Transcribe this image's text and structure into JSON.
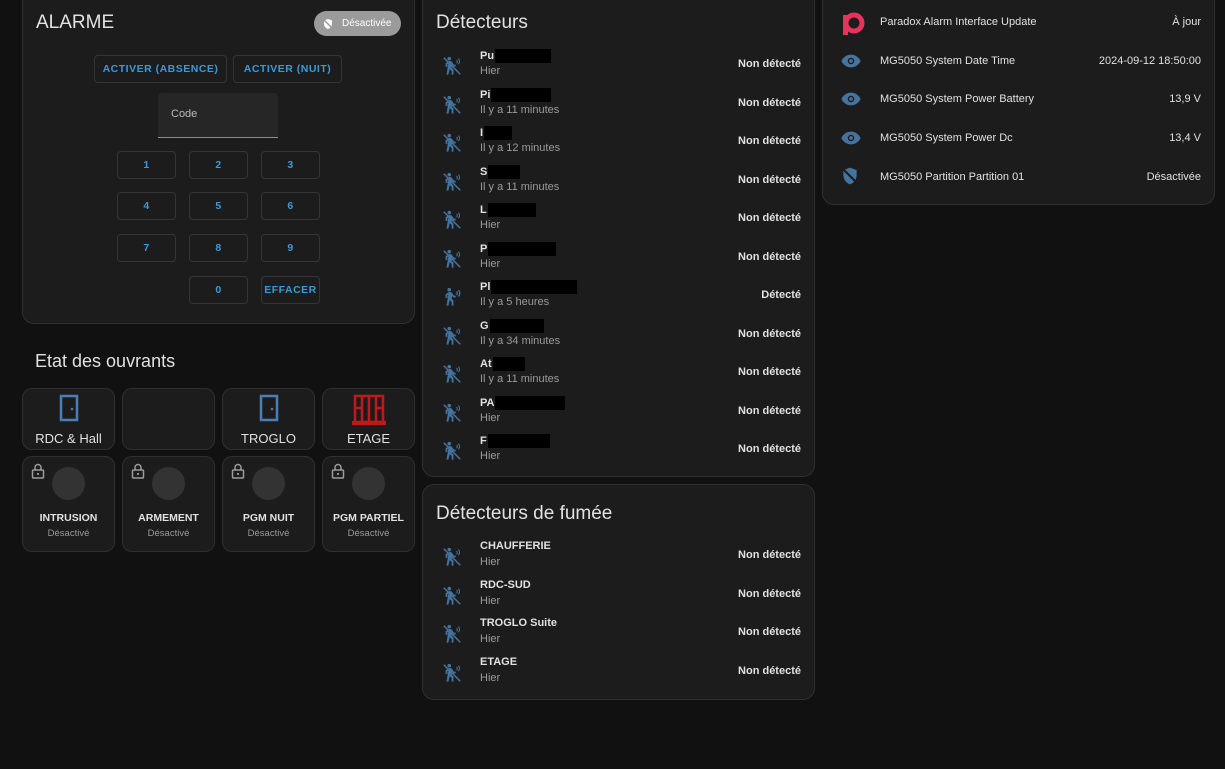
{
  "alarm": {
    "title": "ALARME",
    "state_badge": "Désactivée",
    "buttons": [
      "ACTIVER (ABSENCE)",
      "ACTIVER (NUIT)"
    ],
    "code_placeholder": "Code",
    "keys": [
      "1",
      "2",
      "3",
      "4",
      "5",
      "6",
      "7",
      "8",
      "9",
      "0"
    ],
    "clear_label": "EFFACER"
  },
  "openings": {
    "title": "Etat des ouvrants",
    "tiles": [
      {
        "label": "RDC & Hall",
        "icon": "door-closed-icon",
        "color": "#4a7fb5"
      },
      {
        "label": "",
        "icon": "",
        "color": ""
      },
      {
        "label": "TROGLO",
        "icon": "door-closed-icon",
        "color": "#4a7fb5"
      },
      {
        "label": "ETAGE",
        "icon": "window-open-icon",
        "color": "#c0181b"
      }
    ],
    "switches": [
      {
        "name": "INTRUSION",
        "state": "Désactivé"
      },
      {
        "name": "ARMEMENT",
        "state": "Désactivé"
      },
      {
        "name": "PGM NUIT",
        "state": "Désactivé"
      },
      {
        "name": "PGM PARTIEL",
        "state": "Désactivé"
      }
    ]
  },
  "detectors": {
    "title": "Détecteurs",
    "items": [
      {
        "name": "Pu",
        "time": "Hier",
        "state": "Non détecté"
      },
      {
        "name": "Pi",
        "time": "Il y a 11 minutes",
        "state": "Non détecté"
      },
      {
        "name": "I",
        "time": "Il y a 12 minutes",
        "state": "Non détecté"
      },
      {
        "name": "S",
        "time": "Il y a 11 minutes",
        "state": "Non détecté"
      },
      {
        "name": "L",
        "time": "Hier",
        "state": "Non détecté"
      },
      {
        "name": "P",
        "time": "Hier",
        "state": "Non détecté"
      },
      {
        "name": "Pl",
        "time": "Il y a 5 heures",
        "state": "Détecté"
      },
      {
        "name": "G",
        "time": "Il y a 34 minutes",
        "state": "Non détecté"
      },
      {
        "name": "At",
        "time": "Il y a 11 minutes",
        "state": "Non détecté"
      },
      {
        "name": "PA",
        "time": "Hier",
        "state": "Non détecté"
      },
      {
        "name": "F",
        "time": "Hier",
        "state": "Non détecté"
      }
    ]
  },
  "smoke": {
    "title": "Détecteurs de fumée",
    "items": [
      {
        "name": "CHAUFFERIE",
        "time": "Hier",
        "state": "Non détecté"
      },
      {
        "name": "RDC-SUD",
        "time": "Hier",
        "state": "Non détecté"
      },
      {
        "name": "TROGLO Suite",
        "time": "Hier",
        "state": "Non détecté"
      },
      {
        "name": "ETAGE",
        "time": "Hier",
        "state": "Non détecté"
      }
    ]
  },
  "entities": {
    "items": [
      {
        "name": "Paradox Alarm Interface Update",
        "value": "À jour",
        "icon": "paradox-logo-icon"
      },
      {
        "name": "MG5050 System Date Time",
        "value": "2024-09-12 18:50:00",
        "icon": "eye-icon"
      },
      {
        "name": "MG5050 System Power Battery",
        "value": "13,9 V",
        "icon": "eye-icon"
      },
      {
        "name": "MG5050 System Power Dc",
        "value": "13,4 V",
        "icon": "eye-icon"
      },
      {
        "name": "MG5050 Partition Partition 01",
        "value": "Désactivée",
        "icon": "shield-off-icon"
      }
    ]
  },
  "colors": {
    "accent": "#3a9ad9",
    "icon": "#44739e",
    "alert": "#c0181b"
  }
}
